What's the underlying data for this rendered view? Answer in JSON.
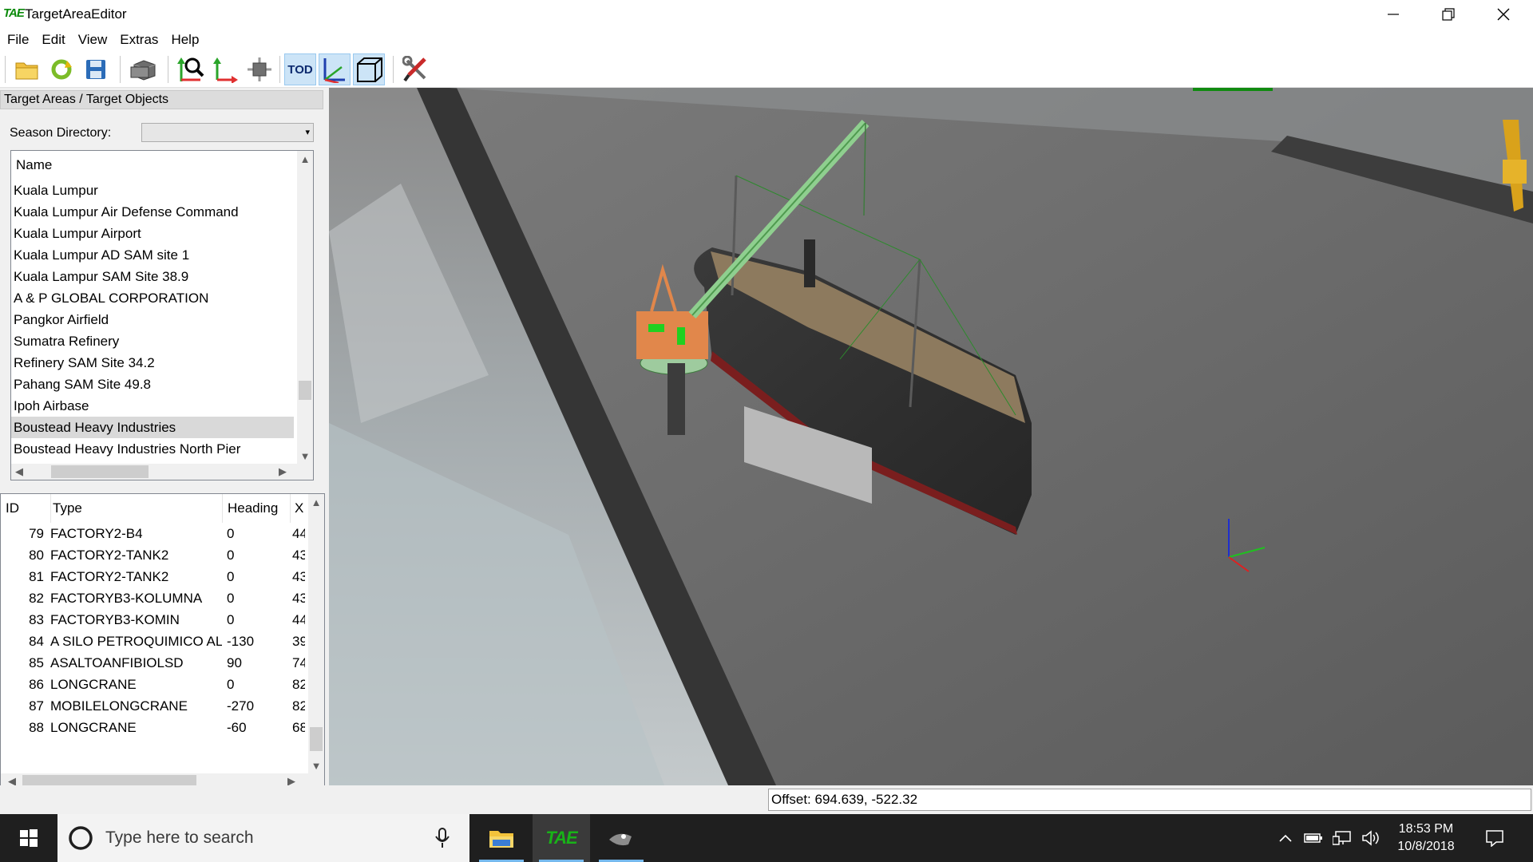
{
  "window": {
    "app_logo": "TAE",
    "title": "TargetAreaEditor",
    "minimize_glyph": "—",
    "restore_glyph": "❐",
    "close_glyph": "✕"
  },
  "menu": [
    "File",
    "Edit",
    "View",
    "Extras",
    "Help"
  ],
  "toolbar": {
    "buttons": [
      "open-folder-icon",
      "reload-icon",
      "save-icon",
      "layers-icon",
      "find-object-icon",
      "move-axis-icon",
      "snap-object-icon",
      "tod-toggle",
      "axis-view-icon",
      "box-view-icon",
      "tools-icon"
    ],
    "tod_label": "TOD"
  },
  "left_panel": {
    "title": "Target Areas / Target Objects",
    "season_label": "Season Directory:",
    "season_value": "",
    "areas_header": "Name",
    "areas": [
      "Kuala Lumpur",
      "Kuala Lumpur Air Defense Command",
      "Kuala Lumpur Airport",
      "Kuala Lumpur AD SAM site 1",
      "Kuala Lampur SAM Site 38.9",
      "A & P GLOBAL CORPORATION",
      "Pangkor Airfield",
      "Sumatra Refinery",
      "Refinery SAM Site 34.2",
      "Pahang SAM Site 49.8",
      "Ipoh Airbase",
      "Boustead Heavy Industries",
      "Boustead Heavy Industries North Pier"
    ],
    "selected_area": "Boustead Heavy Industries",
    "objects_headers": {
      "id": "ID",
      "type": "Type",
      "heading": "Heading",
      "x": "X"
    },
    "objects": [
      {
        "id": "79",
        "type": "FACTORY2-B4",
        "heading": "0",
        "x": "44"
      },
      {
        "id": "80",
        "type": "FACTORY2-TANK2",
        "heading": "0",
        "x": "43"
      },
      {
        "id": "81",
        "type": "FACTORY2-TANK2",
        "heading": "0",
        "x": "43"
      },
      {
        "id": "82",
        "type": "FACTORYB3-KOLUMNA",
        "heading": "0",
        "x": "43"
      },
      {
        "id": "83",
        "type": "FACTORYB3-KOMIN",
        "heading": "0",
        "x": "44"
      },
      {
        "id": "84",
        "type": "A SILO PETROQUIMICO AL",
        "heading": "-130",
        "x": "39"
      },
      {
        "id": "85",
        "type": "ASALTOANFIBIOLSD",
        "heading": "90",
        "x": "74"
      },
      {
        "id": "86",
        "type": "LONGCRANE",
        "heading": "0",
        "x": "82"
      },
      {
        "id": "87",
        "type": "MOBILELONGCRANE",
        "heading": "-270",
        "x": "82"
      },
      {
        "id": "88",
        "type": "LONGCRANE",
        "heading": "-60",
        "x": "68"
      }
    ]
  },
  "status": {
    "offset": "Offset: 694.639, -522.32"
  },
  "taskbar": {
    "search_placeholder": "Type here to search",
    "time": "18:53 PM",
    "date": "10/8/2018",
    "tae_label": "TAE"
  },
  "colors": {
    "accent": "#0a8a0a",
    "selection": "#d9d9d9",
    "taskbar": "#1f1f1f",
    "tod_active": "#cce4f7"
  }
}
